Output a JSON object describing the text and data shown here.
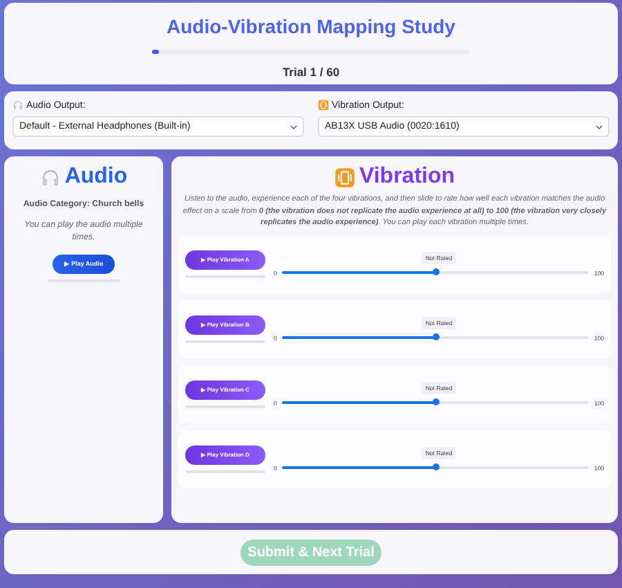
{
  "header": {
    "title": "Audio-Vibration Mapping Study",
    "progress": {
      "level": 0.02
    },
    "trial": "Trial 1 / 60"
  },
  "outputs": [
    {
      "label": "Audio Output:",
      "kind": "audio",
      "value": "Default - External Headphones (Built-in)"
    },
    {
      "label": "Vibration Output:",
      "kind": "vibration",
      "value": "AB13X USB Audio (0020:1610)"
    }
  ],
  "audio": {
    "title": "Audio",
    "category": "Audio Category: Church bells",
    "note": "You can play the audio multiple times.",
    "button": "▶ Play Audio",
    "playback": {
      "level": 0
    }
  },
  "vibration": {
    "title": "Vibration",
    "instructions": "Listen to the audio, experience each of the four vibrations, and then slide to rate how well each vibration matches the audio effect on a scale from **0 (the vibration does not replicate the audio experience at all) to 100 (the vibration very closely replicates the audio experience)**. You can play each vibration multiple times.",
    "items": [
      {
        "button": "▶ Play Vibration A",
        "playback": {
          "level": 0
        },
        "rating": "Not Rated",
        "min": "0",
        "max": "100",
        "level": 0.5
      },
      {
        "button": "▶ Play Vibration B",
        "playback": {
          "level": 0
        },
        "rating": "Not Rated",
        "min": "0",
        "max": "100",
        "level": 0.5
      },
      {
        "button": "▶ Play Vibration C",
        "playback": {
          "level": 0
        },
        "rating": "Not Rated",
        "min": "0",
        "max": "100",
        "level": 0.5
      },
      {
        "button": "▶ Play Vibration D",
        "playback": {
          "level": 0
        },
        "rating": "Not Rated",
        "min": "0",
        "max": "100",
        "level": 0.5
      }
    ]
  },
  "submit": {
    "label": "Submit & Next Trial",
    "disabled": true
  }
}
